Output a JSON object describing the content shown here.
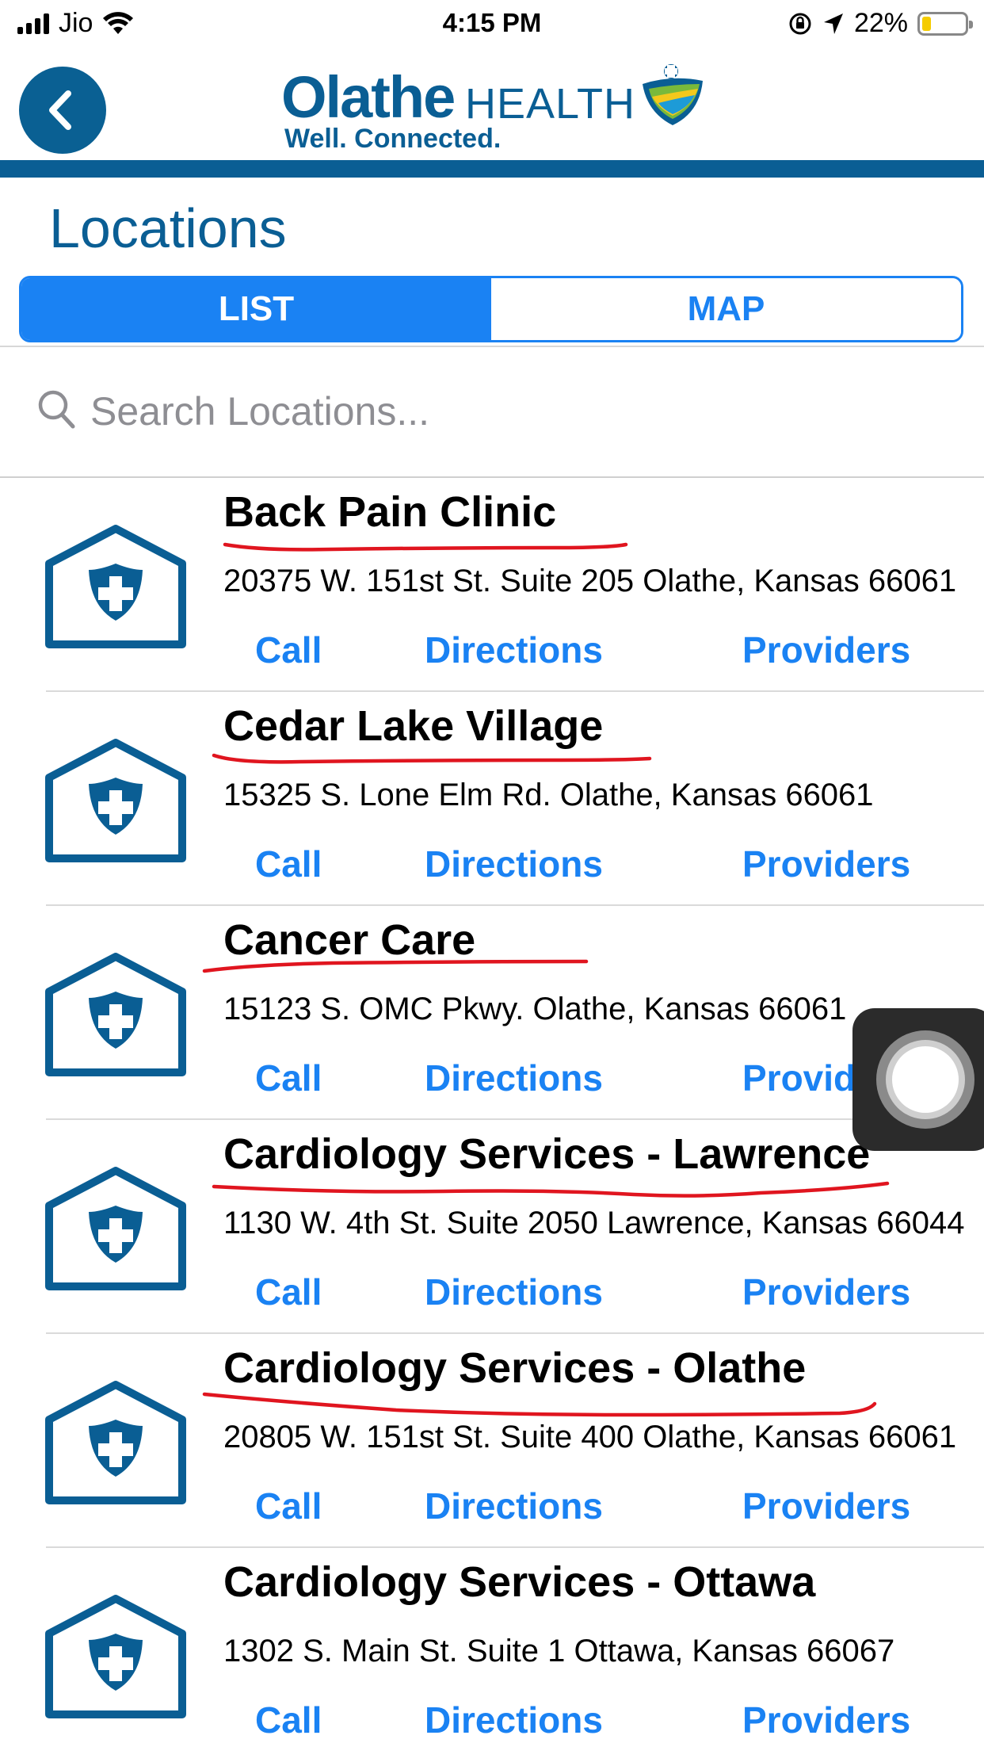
{
  "status_bar": {
    "carrier": "Jio",
    "time": "4:15 PM",
    "battery": "22%",
    "battery_level": 0.22,
    "battery_color": "#f5cc00"
  },
  "header": {
    "logo_word1": "Olathe",
    "logo_word2": "HEALTH",
    "logo_tagline": "Well. Connected.",
    "back_icon": "chevron-left-icon",
    "brand_color": "#0a5e94"
  },
  "page": {
    "title": "Locations"
  },
  "segmented": {
    "list_label": "LIST",
    "map_label": "MAP",
    "selected": "LIST",
    "accent_color": "#1a82f3"
  },
  "search": {
    "placeholder": "Search Locations...",
    "value": "",
    "icon": "search-icon"
  },
  "locations": [
    {
      "name": "Back Pain Clinic",
      "address": "20375 W. 151st St. Suite 205 Olathe, Kansas 66061",
      "call": "Call",
      "directions": "Directions",
      "providers": "Providers"
    },
    {
      "name": "Cedar Lake Village",
      "address": "15325 S. Lone Elm Rd. Olathe, Kansas 66061",
      "call": "Call",
      "directions": "Directions",
      "providers": "Providers"
    },
    {
      "name": "Cancer Care",
      "address": "15123 S. OMC Pkwy. Olathe, Kansas 66061",
      "call": "Call",
      "directions": "Directions",
      "providers": "Providers"
    },
    {
      "name": "Cardiology Services - Lawrence",
      "address": "1130 W. 4th St. Suite 2050 Lawrence, Kansas 66044",
      "call": "Call",
      "directions": "Directions",
      "providers": "Providers"
    },
    {
      "name": "Cardiology Services - Olathe",
      "address": "20805 W. 151st St. Suite 400 Olathe, Kansas 66061",
      "call": "Call",
      "directions": "Directions",
      "providers": "Providers"
    },
    {
      "name": "Cardiology Services - Ottawa",
      "address": "1302 S. Main St. Suite 1 Ottawa, Kansas 66067",
      "call": "Call",
      "directions": "Directions",
      "providers": "Providers"
    }
  ],
  "annotations": {
    "underline_color": "#e0151f"
  }
}
